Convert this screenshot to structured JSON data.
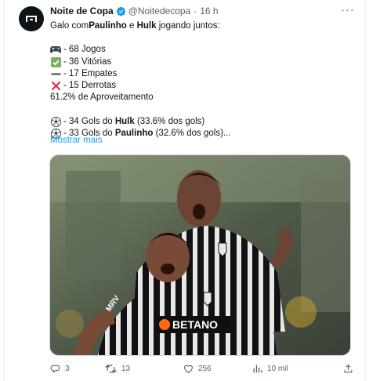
{
  "author": {
    "name": "Noite de Copa",
    "handle": "@Noitedecopa",
    "time": "16 h",
    "avatar_icon": "dark-round-logo"
  },
  "tweet": {
    "intro_pre": "Galo com ",
    "intro_p1": "Paulinho",
    "intro_mid": " e ",
    "intro_p2": "Hulk",
    "intro_post": " jogando juntos:",
    "jogos": "- 68 Jogos",
    "vitorias": "- 36 Vitórias",
    "empates": "- 17 Empates",
    "derrotas": "- 15 Derrotas",
    "aproveitamento": "61.2% de Aproveitamento",
    "gols_hulk_pre": "- 34 Gols do ",
    "gols_hulk_name": "Hulk",
    "gols_hulk_post": " (33.6% dos gols)",
    "gols_paulinho_pre": "- 33 Gols do ",
    "gols_paulinho_name": "Paulinho",
    "gols_paulinho_post": " (32.6% dos gols)...",
    "show_more": "Mostrar mais"
  },
  "media": {
    "sponsor": "BETANO",
    "sponsor_sleeve": "MRV"
  },
  "actions": {
    "replies": "3",
    "retweets": "13",
    "likes": "256",
    "views": "10 mil"
  },
  "colors": {
    "link": "#1d9bf0",
    "secondary": "#536471",
    "verified": "#1d9bf0"
  }
}
